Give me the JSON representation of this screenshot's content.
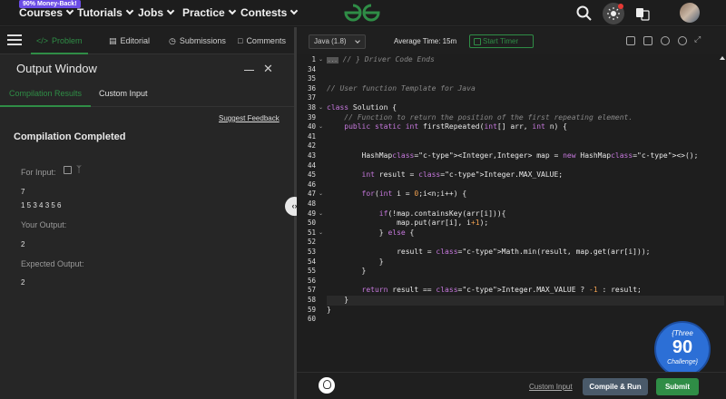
{
  "topnav": {
    "promo": "90% Money-Back!",
    "items": [
      "Courses",
      "Tutorials",
      "Jobs",
      "Practice",
      "Contests"
    ],
    "logo": "GfG",
    "icons": [
      "search-icon",
      "theme-toggle-icon",
      "translate-icon",
      "avatar"
    ]
  },
  "left_tabs": {
    "problem": "Problem",
    "editorial": "Editorial",
    "submissions": "Submissions",
    "comments": "Comments"
  },
  "output": {
    "title": "Output Window",
    "tab_results": "Compilation Results",
    "tab_custom": "Custom Input",
    "feedback": "Suggest Feedback",
    "status": "Compilation Completed",
    "for_input_label": "For Input:",
    "input_line1": "7",
    "input_line2": "1 5 3 4 3 5 6",
    "your_output_label": "Your Output:",
    "your_output": "2",
    "expected_label": "Expected Output:",
    "expected": "2"
  },
  "toolbar": {
    "language": "Java (1.8)",
    "avg_time": "Average Time: 15m",
    "timer": "Start Timer"
  },
  "code": {
    "line_numbers": [
      "1",
      "34",
      "35",
      "36",
      "37",
      "38",
      "39",
      "40",
      "41",
      "42",
      "43",
      "44",
      "45",
      "46",
      "47",
      "48",
      "49",
      "50",
      "51",
      "52",
      "53",
      "54",
      "55",
      "56",
      "57",
      "58",
      "59",
      "60"
    ],
    "lines": [
      "// } Driver Code Ends",
      "",
      "",
      "// User function Template for Java",
      "",
      "class Solution {",
      "    // Function to return the position of the first repeating element.",
      "    public static int firstRepeated(int[] arr, int n) {",
      "",
      "",
      "        HashMap<Integer,Integer> map = new HashMap<>();",
      "",
      "        int result = Integer.MAX_VALUE;",
      "",
      "        for(int i = 0;i<n;i++) {",
      "",
      "            if(!map.containsKey(arr[i])){",
      "                map.put(arr[i], i+1);",
      "            } else {",
      "",
      "                result = Math.min(result, map.get(arr[i]));",
      "            }",
      "        }",
      "",
      "        return result == Integer.MAX_VALUE ? -1 : result;",
      "    }",
      "}",
      ""
    ]
  },
  "badge": {
    "top": "{Three",
    "number": "90",
    "bottom": "Challenge}"
  },
  "bottom": {
    "custom_input": "Custom Input",
    "compile": "Compile & Run",
    "submit": "Submit"
  },
  "colors": {
    "accent": "#2f8d46",
    "badge": "#2c6fd6"
  }
}
